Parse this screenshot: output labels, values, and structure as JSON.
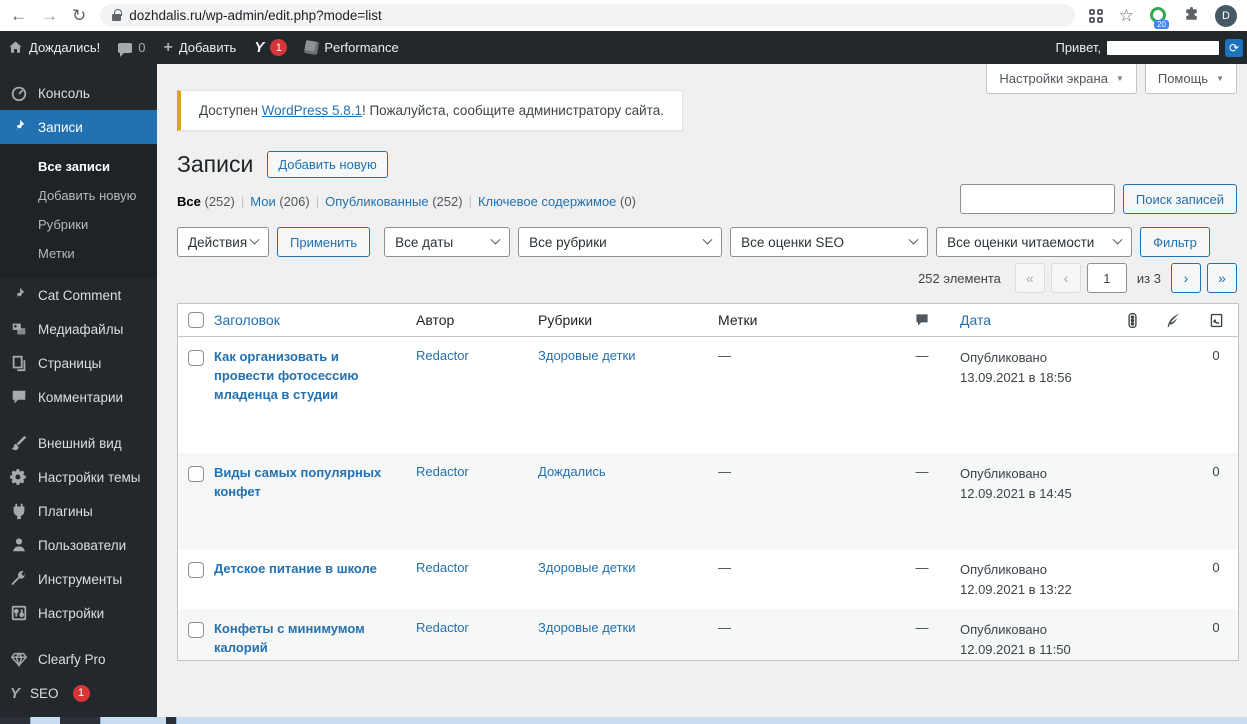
{
  "browser": {
    "url": "dozhdalis.ru/wp-admin/edit.php?mode=list",
    "extension_count": "20",
    "avatar_letter": "D"
  },
  "admin_bar": {
    "site_name": "Дождались!",
    "comment_count": "0",
    "add_label": "Добавить",
    "yoast_badge": "1",
    "performance_label": "Performance",
    "greeting": "Привет,"
  },
  "screen_tabs": {
    "screen_options": "Настройки экрана",
    "help": "Помощь"
  },
  "sidebar": {
    "items": [
      {
        "label": "Консоль",
        "icon": "dashboard-icon"
      },
      {
        "label": "Записи",
        "icon": "pushpin-icon"
      },
      {
        "label": "Cat Comment",
        "icon": "pushpin-icon"
      },
      {
        "label": "Медиафайлы",
        "icon": "media-icon"
      },
      {
        "label": "Страницы",
        "icon": "pages-icon"
      },
      {
        "label": "Комментарии",
        "icon": "comments-icon"
      },
      {
        "label": "Внешний вид",
        "icon": "appearance-icon"
      },
      {
        "label": "Настройки темы",
        "icon": "gear-icon"
      },
      {
        "label": "Плагины",
        "icon": "plugin-icon"
      },
      {
        "label": "Пользователи",
        "icon": "users-icon"
      },
      {
        "label": "Инструменты",
        "icon": "tools-icon"
      },
      {
        "label": "Настройки",
        "icon": "settings-icon"
      },
      {
        "label": "Clearfy Pro",
        "icon": "diamond-icon"
      },
      {
        "label": "SEO",
        "icon": "yoast-icon",
        "badge": "1"
      }
    ],
    "posts_submenu": [
      {
        "label": "Все записи",
        "current": true
      },
      {
        "label": "Добавить новую"
      },
      {
        "label": "Рубрики"
      },
      {
        "label": "Метки"
      }
    ]
  },
  "notice": {
    "prefix": "Доступен ",
    "link": "WordPress 5.8.1",
    "suffix": "! Пожалуйста, сообщите администратору сайта."
  },
  "page": {
    "title": "Записи",
    "add_new": "Добавить новую"
  },
  "views": [
    {
      "label": "Все",
      "count": "(252)",
      "current": true
    },
    {
      "label": "Мои",
      "count": "(206)"
    },
    {
      "label": "Опубликованные",
      "count": "(252)"
    },
    {
      "label": "Ключевое содержимое",
      "count": "(0)"
    }
  ],
  "search": {
    "button": "Поиск записей",
    "value": ""
  },
  "filters": {
    "actions": "Действия",
    "apply": "Применить",
    "dates": "Все даты",
    "categories": "Все рубрики",
    "seo_scores": "Все оценки SEO",
    "readability_scores": "Все оценки читаемости",
    "filter": "Фильтр"
  },
  "pagination": {
    "total": "252 элемента",
    "first": "«",
    "prev": "‹",
    "current_page": "1",
    "of": "из 3",
    "next": "›",
    "last": "»"
  },
  "table": {
    "headers": {
      "title": "Заголовок",
      "author": "Автор",
      "categories": "Рубрики",
      "tags": "Метки",
      "comments_icon": "comment-bubble-icon",
      "date": "Дата",
      "seo_icon": "seo-traffic-light-icon",
      "readability_icon": "readability-feather-icon",
      "links_icon": "internal-links-icon"
    },
    "rows": [
      {
        "title": "Как организовать и провести фотосессию младенца в студии",
        "author": "Redactor",
        "category": "Здоровые детки",
        "tags": "—",
        "comments": "—",
        "status": "Опубликовано",
        "date": "13.09.2021 в 18:56",
        "seo_dot": "#9da0a5",
        "readability_dot": "#ee8e0d",
        "links": "0"
      },
      {
        "title": "Виды самых популярных конфет",
        "author": "Redactor",
        "category": "Дождались",
        "tags": "—",
        "comments": "—",
        "status": "Опубликовано",
        "date": "12.09.2021 в 14:45",
        "seo_dot": "#9da0a5",
        "readability_dot": "#dc3232",
        "links": "0"
      },
      {
        "title": "Детское питание в школе",
        "author": "Redactor",
        "category": "Здоровые детки",
        "tags": "—",
        "comments": "—",
        "status": "Опубликовано",
        "date": "12.09.2021 в 13:22",
        "seo_dot": "#9da0a5",
        "readability_dot": "#dc3232",
        "links": "0"
      },
      {
        "title": "Конфеты с минимумом калорий",
        "author": "Redactor",
        "category": "Здоровые детки",
        "tags": "—",
        "comments": "—",
        "status": "Опубликовано",
        "date": "12.09.2021 в 11:50",
        "seo_dot": "#9da0a5",
        "readability_dot": "#ee8e0d",
        "links": "0"
      }
    ]
  },
  "colors": {
    "accent": "#2271b1",
    "admin_bar_bg": "#23282d",
    "notice_border": "#dba617",
    "seo_gray": "#9da0a5",
    "seo_orange": "#ee8e0d",
    "seo_red": "#dc3232"
  }
}
